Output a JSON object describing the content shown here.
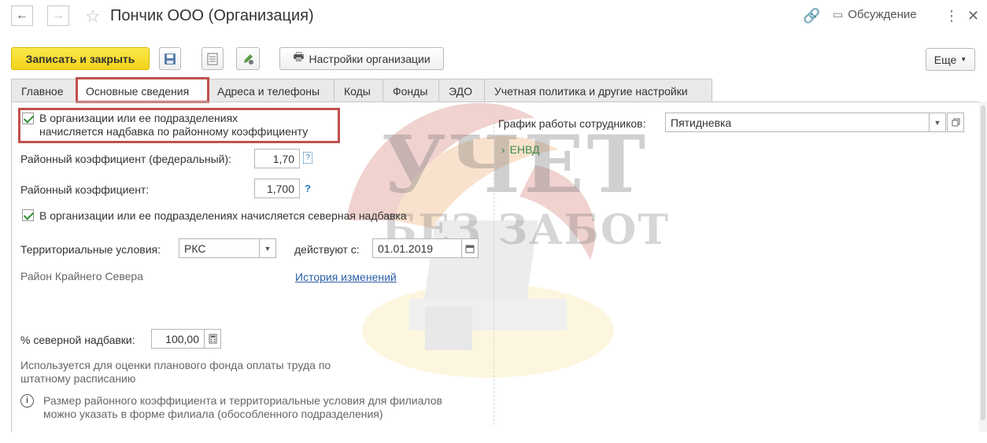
{
  "header": {
    "title": "Пончик ООО (Организация)",
    "discuss_label": "Обсуждение"
  },
  "toolbar": {
    "save_close_label": "Записать и закрыть",
    "org_settings_label": "Настройки организации",
    "more_label": "Еще"
  },
  "tabs": [
    {
      "label": "Главное"
    },
    {
      "label": "Основные сведения",
      "active": true
    },
    {
      "label": "Адреса и телефоны"
    },
    {
      "label": "Коды"
    },
    {
      "label": "Фонды"
    },
    {
      "label": "ЭДО"
    },
    {
      "label": "Учетная политика и другие настройки"
    }
  ],
  "form": {
    "district_coef_checkbox": {
      "checked": true,
      "label_line1": "В организации или ее подразделениях",
      "label_line2": "начисляется надбавка по районному коэффициенту"
    },
    "coef_federal_label": "Районный коэффициент (федеральный):",
    "coef_federal_value": "1,70",
    "coef_label": "Районный коэффициент:",
    "coef_value": "1,700",
    "coef_help": "?",
    "northern_checkbox": {
      "checked": true,
      "label": "В организации или ее подразделениях начисляется северная надбавка"
    },
    "territorial_label": "Территориальные условия:",
    "territorial_value": "РКС",
    "valid_from_label": "действуют с:",
    "valid_from_value": "01.01.2019",
    "territory_description": "Район Крайнего Севера",
    "history_link": "История изменений",
    "northern_pct_label": "% северной надбавки:",
    "northern_pct_value": "100,00",
    "hint_line1": "Используется для оценки планового фонда оплаты труда по",
    "hint_line2": "штатному расписанию",
    "info_line1": "Размер районного коэффициента и территориальные условия для филиалов",
    "info_line2": "можно указать в форме филиала (обособленного подразделения)",
    "schedule_label": "График работы сотрудников:",
    "schedule_value": "Пятидневка",
    "envd_label": "ЕНВД"
  },
  "watermark": {
    "line1": "УЧЕТ",
    "line2": "БЕЗ ЗАБОТ"
  },
  "colors": {
    "primary_button": "#f2d21a",
    "highlight_border": "#c0504d",
    "check_green": "#2f8f3a",
    "link_blue": "#2a5ea8"
  }
}
